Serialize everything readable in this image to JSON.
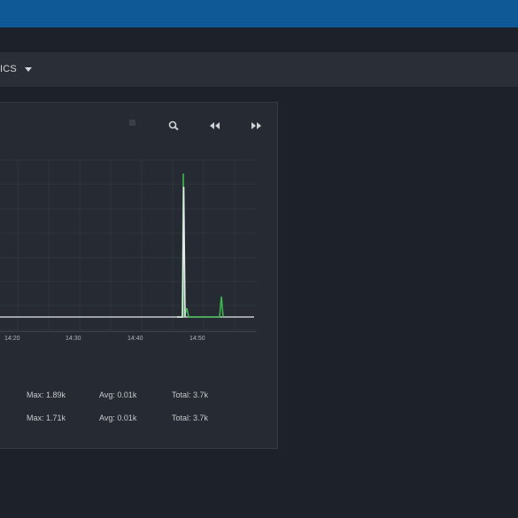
{
  "toolbar": {
    "label": "ICS"
  },
  "chart": {
    "controls": {
      "zoom_icon": "zoom-icon",
      "rewind_icon": "rewind-icon",
      "forward_icon": "fast-forward-icon"
    },
    "x_ticks": [
      "14:20",
      "14:30",
      "14:40",
      "14:50"
    ]
  },
  "chart_data": {
    "type": "line",
    "x": [
      "14:20",
      "14:30",
      "14:40",
      "14:50"
    ],
    "series": [
      {
        "max": "Max: 1.89k",
        "avg": "Avg: 0.01k",
        "total": "Total: 3.7k",
        "color": "#3fb44f"
      },
      {
        "max": "Max: 1.71k",
        "avg": "Avg: 0.01k",
        "total": "Total: 3.7k",
        "color": "#d7dbe0"
      }
    ]
  },
  "colors": {
    "accent": "#0f5a96",
    "panel": "#262b33",
    "green": "#3fb44f",
    "white_line": "#d7dbe0"
  }
}
